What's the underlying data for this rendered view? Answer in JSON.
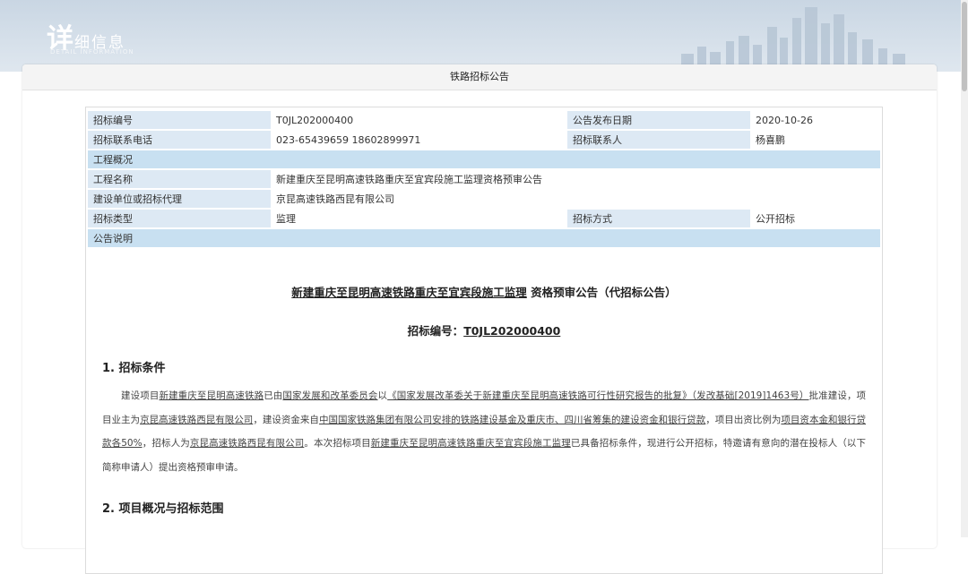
{
  "banner": {
    "logo_big": "详",
    "logo_rest": "细信息",
    "logo_sub": "DETAIL INFORMATION"
  },
  "window": {
    "title": "铁路招标公告"
  },
  "info_rows": [
    {
      "cells": [
        {
          "type": "lbl",
          "text": "招标编号"
        },
        {
          "type": "val",
          "text": "T0JL202000400"
        },
        {
          "type": "lbl",
          "text": "公告发布日期"
        },
        {
          "type": "val",
          "text": "2020-10-26"
        }
      ]
    },
    {
      "cells": [
        {
          "type": "lbl",
          "text": "招标联系电话"
        },
        {
          "type": "val",
          "text": "023-65439659 18602899971"
        },
        {
          "type": "lbl",
          "text": "招标联系人"
        },
        {
          "type": "val",
          "text": "杨喜鹏"
        }
      ]
    },
    {
      "cells": [
        {
          "type": "section",
          "text": "工程概况",
          "span": 4
        }
      ]
    },
    {
      "cells": [
        {
          "type": "lbl",
          "text": "工程名称"
        },
        {
          "type": "val",
          "text": "新建重庆至昆明高速铁路重庆至宜宾段施工监理资格预审公告",
          "span": 3
        }
      ]
    },
    {
      "cells": [
        {
          "type": "lbl",
          "text": "建设单位或招标代理"
        },
        {
          "type": "val",
          "text": "京昆高速铁路西昆有限公司",
          "span": 3
        }
      ]
    },
    {
      "cells": [
        {
          "type": "lbl",
          "text": "招标类型"
        },
        {
          "type": "val",
          "text": "监理"
        },
        {
          "type": "lbl",
          "text": "招标方式"
        },
        {
          "type": "val",
          "text": "公开招标"
        }
      ]
    },
    {
      "cells": [
        {
          "type": "section",
          "text": "公告说明",
          "span": 4
        }
      ]
    }
  ],
  "doc": {
    "title_u": "新建重庆至昆明高速铁路重庆至宜宾段施工监理",
    "title_rest": "资格预审公告（代招标公告）",
    "no_label": "招标编号：",
    "no_value": "T0JL202000400",
    "h1": "1. 招标条件",
    "p1": [
      {
        "t": "建设项目"
      },
      {
        "t": "新建重庆至昆明高速铁路",
        "u": true
      },
      {
        "t": "已由"
      },
      {
        "t": "国家发展和改革委员会",
        "u": true
      },
      {
        "t": "以"
      },
      {
        "t": "《国家发展改革委关于新建重庆至昆明高速铁路可行性研究报告的批复》（发改基础[2019]1463号）",
        "u": true
      },
      {
        "t": "批准建设，项目业主为"
      },
      {
        "t": "京昆高速铁路西昆有限公司",
        "u": true
      },
      {
        "t": "，建设资金来自"
      },
      {
        "t": "中国国家铁路集团有限公司安排的铁路建设基金及重庆市、四川省筹集的建设资金和银行贷款",
        "u": true
      },
      {
        "t": "，项目出资比例为"
      },
      {
        "t": "项目资本金和银行贷款各50%",
        "u": true
      },
      {
        "t": "，招标人为"
      },
      {
        "t": "京昆高速铁路西昆有限公司",
        "u": true
      },
      {
        "t": "。本次招标项目"
      },
      {
        "t": "新建重庆至昆明高速铁路重庆至宜宾段施工监理",
        "u": true
      },
      {
        "t": "已具备招标条件，现进行公开招标，特邀请有意向的潜在投标人（以下简称申请人）提出资格预审申请。"
      }
    ],
    "h2": "2. 项目概况与招标范围"
  }
}
